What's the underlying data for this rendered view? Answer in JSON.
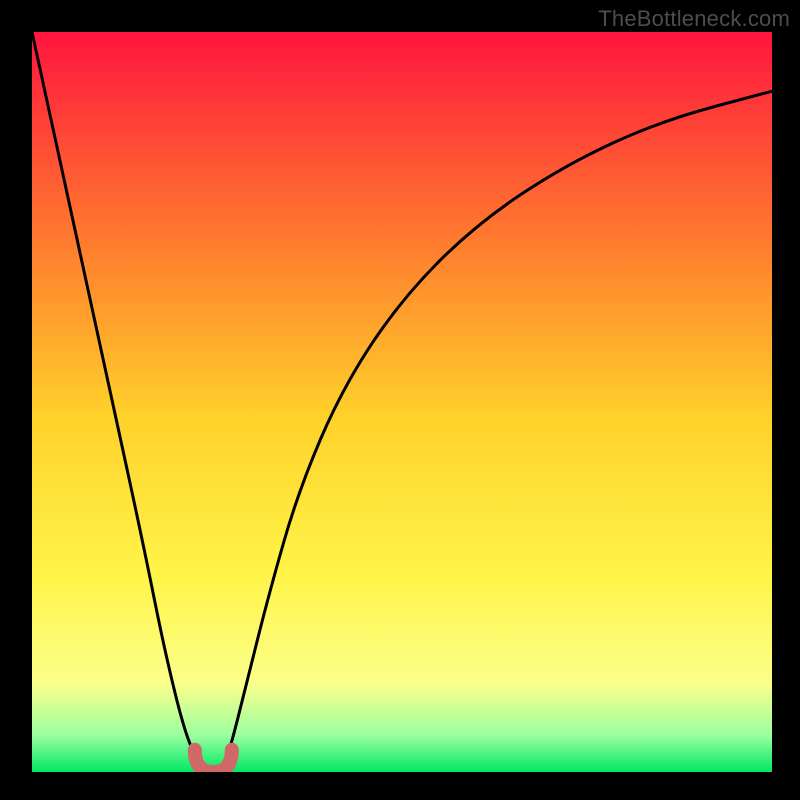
{
  "watermark": "TheBottleneck.com",
  "colors": {
    "background": "#000000",
    "grad_top": "#ff153e",
    "grad_mid_upper": "#ff7a2e",
    "grad_mid": "#ffd12a",
    "grad_mid_lower": "#fff54a",
    "grad_lower_yellow": "#fbff8b",
    "grad_green_light": "#9cffa0",
    "grad_green": "#00e865",
    "curve_stroke": "#000000",
    "highlight_stroke": "#d06868"
  },
  "chart_data": {
    "type": "line",
    "title": "",
    "xlabel": "",
    "ylabel": "",
    "xlim": [
      0,
      100
    ],
    "ylim": [
      0,
      100
    ],
    "series": [
      {
        "name": "bottleneck-curve",
        "x": [
          0,
          5,
          10,
          15,
          18,
          21,
          23,
          24,
          25,
          26,
          27,
          29,
          32,
          36,
          42,
          50,
          60,
          72,
          85,
          100
        ],
        "values": [
          100,
          77,
          54,
          31,
          16,
          4,
          1,
          0.5,
          0.5,
          1,
          4,
          12,
          24,
          38,
          52,
          64,
          74,
          82,
          88,
          92
        ]
      }
    ],
    "annotations": [
      {
        "name": "valley-highlight",
        "x_range": [
          22,
          27
        ],
        "y_range": [
          0,
          3
        ]
      }
    ]
  }
}
